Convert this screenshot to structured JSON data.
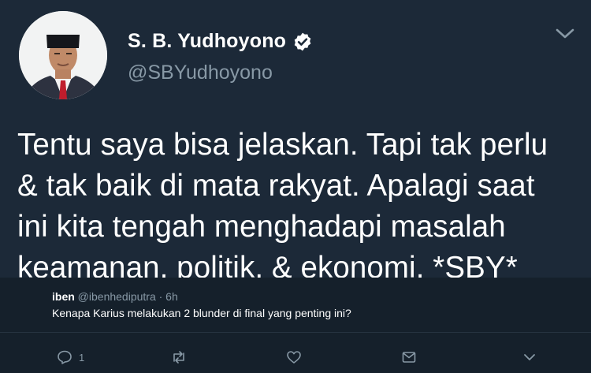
{
  "user": {
    "display_name": "S. B. Yudhoyono",
    "handle": "@SBYudhoyono",
    "verified_icon": "verified-badge-icon"
  },
  "tweet": {
    "lines": [
      "Tentu saya bisa jelaskan. Tapi tak perlu",
      "& tak baik di mata rakyat. Apalagi saat",
      "ini kita tengah menghadapi masalah",
      "keamanan, politik, & ekonomi. *SBY*"
    ]
  },
  "reply": {
    "name": "iben",
    "handle": "@ibenhediputra",
    "time": "· 6h",
    "text": "Kenapa Karius melakukan 2 blunder di final yang penting ini?"
  },
  "actions": {
    "reply_count": "1"
  },
  "colors": {
    "background": "#1c2938",
    "reply_background": "#15202b",
    "secondary_text": "#8899a6",
    "icon": "#8899a6"
  }
}
